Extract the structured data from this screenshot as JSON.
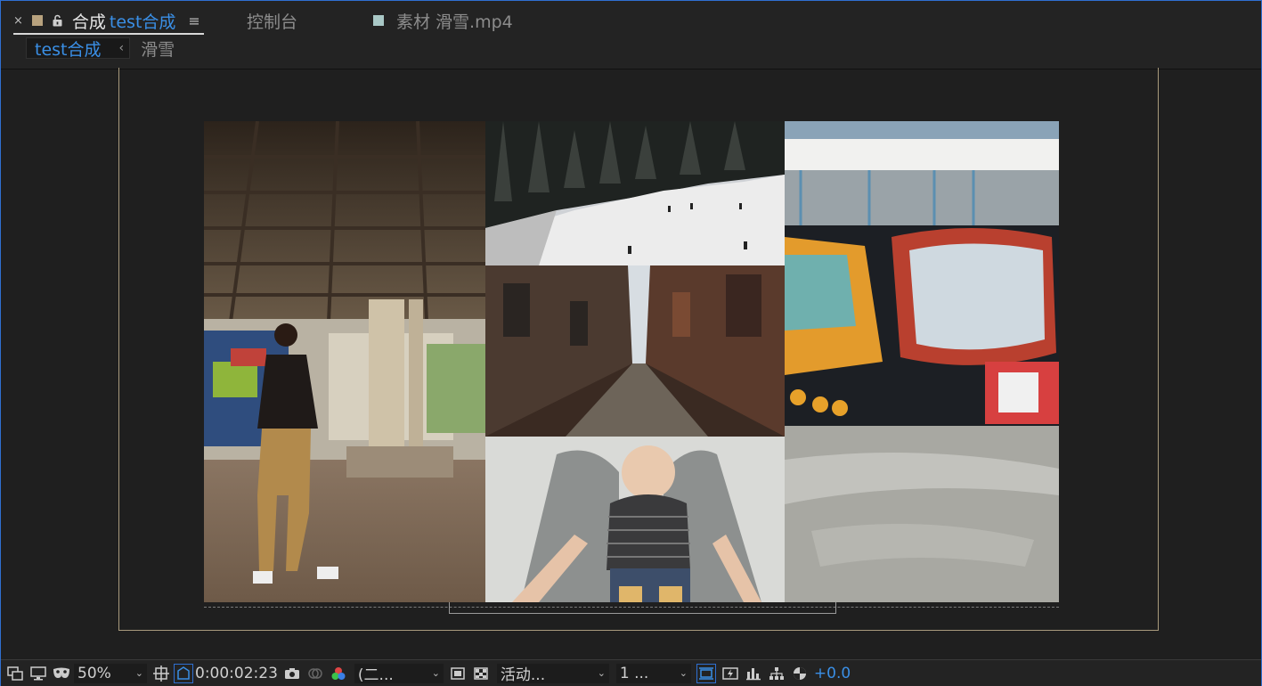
{
  "tabs": {
    "comp_prefix": "合成",
    "comp_name": "test合成",
    "console": "控制台",
    "footage": "素材 滑雪.mp4",
    "swatch_comp": "#b8a27e",
    "swatch_footage": "#a9c8c6"
  },
  "breadcrumb": {
    "active": "test合成",
    "next": "滑雪"
  },
  "icons": {
    "close": "×",
    "menu": "≡",
    "chevron_left": "‹",
    "chevron_down": "⌄"
  },
  "toolbar": {
    "zoom": "50%",
    "timecode": "0:00:02:23",
    "resolution": "(二...",
    "camera": "活动...",
    "views": "1 ...",
    "exposure": "+0.0"
  },
  "colors": {
    "accent": "#2f6fd1",
    "link_blue": "#3a8fe6",
    "safe_margin": "#a89a7c"
  }
}
